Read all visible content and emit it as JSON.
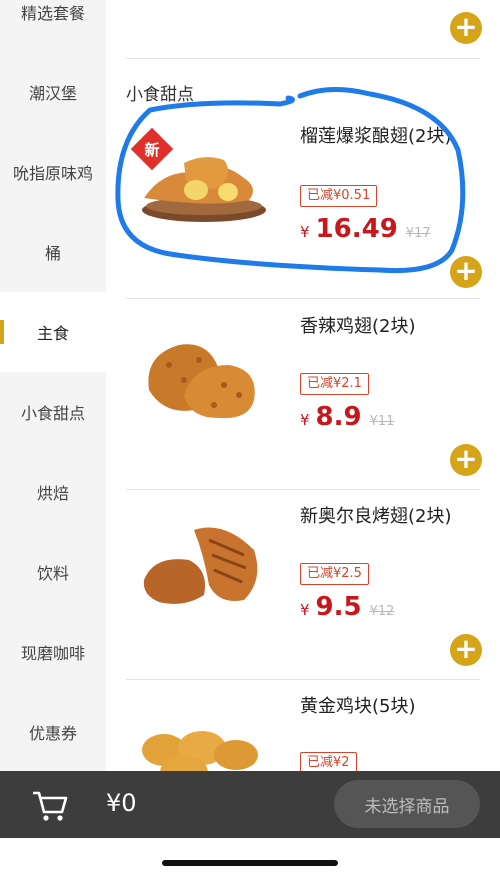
{
  "sidebar": {
    "items": [
      {
        "label": "精选套餐"
      },
      {
        "label": "潮汉堡"
      },
      {
        "label": "吮指原味鸡"
      },
      {
        "label": "桶"
      },
      {
        "label": "主食"
      },
      {
        "label": "小食甜点"
      },
      {
        "label": "烘焙"
      },
      {
        "label": "饮料"
      },
      {
        "label": "现磨咖啡"
      },
      {
        "label": "优惠券"
      }
    ],
    "active_index": 4
  },
  "main": {
    "section_title": "小食甜点",
    "products": [
      {
        "name": "榴莲爆浆酿翅(2块)",
        "badge": "新",
        "discount": "已减¥0.51",
        "yen": "¥",
        "price": "16.49",
        "original_price": "¥17"
      },
      {
        "name": "香辣鸡翅(2块)",
        "discount": "已减¥2.1",
        "yen": "¥",
        "price": "8.9",
        "original_price": "¥11"
      },
      {
        "name": "新奥尔良烤翅(2块)",
        "discount": "已减¥2.5",
        "yen": "¥",
        "price": "9.5",
        "original_price": "¥12"
      },
      {
        "name": "黄金鸡块(5块)",
        "discount": "已减¥2"
      }
    ],
    "add_symbol": "+"
  },
  "cart": {
    "total": "¥0",
    "checkout_label": "未选择商品",
    "icon": "cart-icon"
  },
  "colors": {
    "accent": "#d6a419",
    "price": "#c8161d",
    "bottom_bar": "#3d3d3d",
    "annotation": "#1e7be8"
  }
}
